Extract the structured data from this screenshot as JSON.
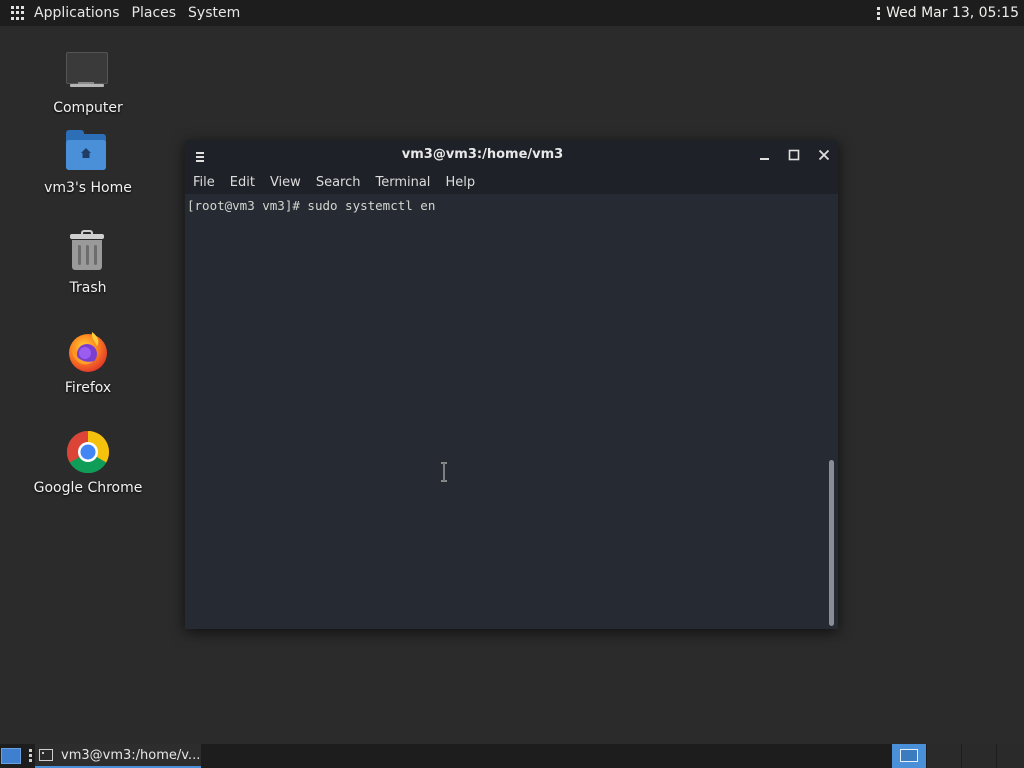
{
  "top_panel": {
    "menus": [
      "Applications",
      "Places",
      "System"
    ],
    "clock": "Wed Mar 13, 05:15"
  },
  "desktop_icons": [
    {
      "label": "Computer",
      "icon": "computer-icon"
    },
    {
      "label": "vm3's Home",
      "icon": "home-folder-icon"
    },
    {
      "label": "Trash",
      "icon": "trash-icon"
    },
    {
      "label": "Firefox",
      "icon": "firefox-icon"
    },
    {
      "label": "Google Chrome",
      "icon": "chrome-icon"
    }
  ],
  "terminal": {
    "title": "vm3@vm3:/home/vm3",
    "menus": [
      "File",
      "Edit",
      "View",
      "Search",
      "Terminal",
      "Help"
    ],
    "prompt": "[root@vm3 vm3]#",
    "command": "sudo systemctl en"
  },
  "taskbar": {
    "task_label": "vm3@vm3:/home/v..."
  },
  "colors": {
    "desktop_bg": "#2b2b2b",
    "panel_bg": "#1d1d1d",
    "terminal_bg": "#262a33",
    "accent": "#4a90d9"
  }
}
